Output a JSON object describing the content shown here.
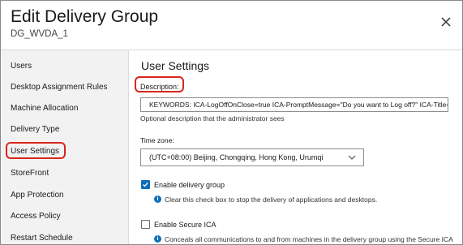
{
  "dialog": {
    "title": "Edit Delivery Group",
    "subtitle": "DG_WVDA_1"
  },
  "sidebar": {
    "items": [
      {
        "label": "Users"
      },
      {
        "label": "Desktop Assignment Rules"
      },
      {
        "label": "Machine Allocation"
      },
      {
        "label": "Delivery Type"
      },
      {
        "label": "User Settings",
        "selected": true
      },
      {
        "label": "StoreFront"
      },
      {
        "label": "App Protection"
      },
      {
        "label": "Access Policy"
      },
      {
        "label": "Restart Schedule"
      }
    ]
  },
  "main": {
    "section_title": "User Settings",
    "description": {
      "label": "Description:",
      "value": "KEYWORDS: ICA-LogOffOnClose=true ICA-PromptMessage=\"Do you want to Log off?\" ICA-Title=\"Log off\"",
      "hint": "Optional description that the administrator sees"
    },
    "time_zone": {
      "label": "Time zone:",
      "selected": "(UTC+08:00) Beijing, Chongqing, Hong Kong, Urumqi"
    },
    "enable_delivery_group": {
      "label": "Enable delivery group",
      "checked": true,
      "info": "Clear this check box to stop the delivery of applications and desktops."
    },
    "enable_secure_ica": {
      "label": "Enable Secure ICA",
      "checked": false,
      "info": "Conceals all communications to and from machines in the delivery group using the Secure ICA"
    }
  },
  "colors": {
    "accent": "#0f6fb8",
    "highlight": "#d9261c",
    "sidebar_bg": "#f2f2f2"
  },
  "icons": {
    "close": "close-icon",
    "dropdown": "chevron-down-icon",
    "info": "info-icon",
    "check": "check-icon"
  }
}
